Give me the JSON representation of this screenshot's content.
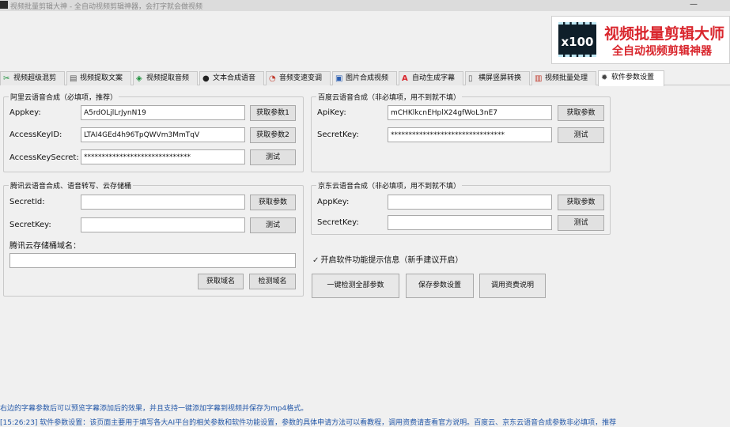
{
  "window": {
    "title": "视频批量剪辑大神 - 全自动视频剪辑神器，会打字就会做视频",
    "minimize_symbol": "—",
    "app_icon": "app-icon"
  },
  "banner": {
    "badge": "x100",
    "title": "视频批量剪辑大师",
    "subtitle": "全自动视频剪辑神器"
  },
  "tabs": [
    {
      "label": "视频超级混剪",
      "icon": "✂",
      "icon_color": "#1b8f3a"
    },
    {
      "label": "视频提取文案",
      "icon": "▤",
      "icon_color": "#555555"
    },
    {
      "label": "视频提取音频",
      "icon": "◈",
      "icon_color": "#1b8f3a"
    },
    {
      "label": "文本合成语音",
      "icon": "●",
      "icon_color": "#222222"
    },
    {
      "label": "音频变速变调",
      "icon": "◔",
      "icon_color": "#c0392b"
    },
    {
      "label": "图片合成视频",
      "icon": "▣",
      "icon_color": "#2a5db0"
    },
    {
      "label": "自动生成字幕",
      "icon": "A",
      "icon_color": "#d9262d"
    },
    {
      "label": "横屏竖屏转换",
      "icon": "▯",
      "icon_color": "#555555"
    },
    {
      "label": "视频批量处理",
      "icon": "▥",
      "icon_color": "#c0392b"
    },
    {
      "label": "软件参数设置",
      "icon": "✹",
      "icon_color": "#444444",
      "active": true
    }
  ],
  "aliyun": {
    "title": "阿里云语音合成（必填项，推荐）",
    "appkey_label": "Appkey:",
    "appkey_value": "A5rdOLjlLrJynN19",
    "appkey_btn": "获取参数1",
    "accesskeyid_label": "AccessKeyID:",
    "accesskeyid_value": "LTAI4GEd4h96TpQWVm3MmTqV",
    "accesskeyid_btn": "获取参数2",
    "secret_label": "AccessKeySecret:",
    "secret_value": "******************************",
    "test_btn": "测试"
  },
  "baidu": {
    "title": "百度云语音合成（非必填项，用不到就不填）",
    "apikey_label": "ApiKey:",
    "apikey_value": "mCHKlkcnEHplX24gfWoL3nE7",
    "apikey_btn": "获取参数",
    "secret_label": "SecretKey:",
    "secret_value": "********************************",
    "test_btn": "测试"
  },
  "tencent": {
    "title": "腾讯云语音合成、语音转写、云存储桶",
    "secretid_label": "SecretId:",
    "secretid_value": "",
    "secretid_btn": "获取参数",
    "secretkey_label": "SecretKey:",
    "secretkey_value": "",
    "test_btn": "测试",
    "bucket_label": "腾讯云存储桶域名：",
    "bucket_value": "",
    "get_domain_btn": "获取域名",
    "check_domain_btn": "检测域名"
  },
  "jd": {
    "title": "京东云语音合成（非必填项，用不到就不填）",
    "appkey_label": "AppKey:",
    "appkey_value": "",
    "appkey_btn": "获取参数",
    "secret_label": "SecretKey:",
    "secret_value": "",
    "test_btn": "测试"
  },
  "options": {
    "check_symbol": "✓",
    "tips_label": "开启软件功能提示信息（新手建议开启）",
    "tips_checked": true
  },
  "actions": {
    "check_all": "一键检测全部参数",
    "save": "保存参数设置",
    "fee_info": "调用资费说明"
  },
  "status": {
    "line1": "右边的字幕参数后可以预览字幕添加后的效果，并且支持一键添加字幕到视频并保存为mp4格式。",
    "line2": "[15:26:23] 软件参数设置：该页面主要用于填写各大AI平台的相关参数和软件功能设置，参数的具体申请方法可以看教程，调用资费请查看官方说明。百度云、京东云语音合成参数非必填项，推荐"
  },
  "colors": {
    "accent_red": "#d9262d",
    "status_blue": "#2357a8",
    "window_bg": "#f0f0f0"
  }
}
